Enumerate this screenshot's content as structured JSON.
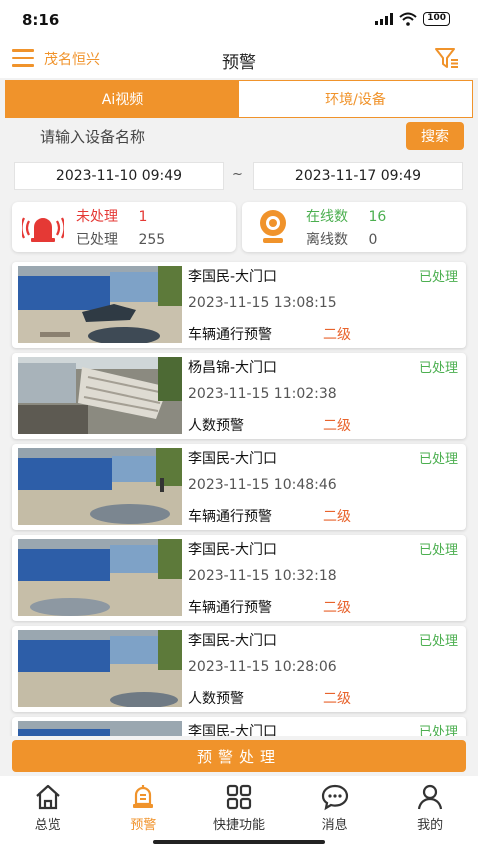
{
  "status_bar": {
    "time": "8:16",
    "battery": "100"
  },
  "header": {
    "company": "茂名恒兴",
    "title": "预警"
  },
  "tabs": [
    {
      "label": "Ai视频",
      "active": true
    },
    {
      "label": "环境/设备",
      "active": false
    }
  ],
  "search": {
    "placeholder": "请输入设备名称",
    "button": "搜索"
  },
  "date_range": {
    "start": "2023-11-10 09:49",
    "separator": "~",
    "end": "2023-11-17 09:49"
  },
  "alarm_stats": {
    "unprocessed_label": "未处理",
    "unprocessed_count": "1",
    "processed_label": "已处理",
    "processed_count": "255"
  },
  "device_stats": {
    "online_label": "在线数",
    "online_count": "16",
    "offline_label": "离线数",
    "offline_count": "0"
  },
  "alerts": [
    {
      "location": "李国民-大门口",
      "status": "已处理",
      "time": "2023-11-15 13:08:15",
      "type": "车辆通行预警",
      "level": "二级"
    },
    {
      "location": "杨昌锦-大门口",
      "status": "已处理",
      "time": "2023-11-15 11:02:38",
      "type": "人数预警",
      "level": "二级"
    },
    {
      "location": "李国民-大门口",
      "status": "已处理",
      "time": "2023-11-15 10:48:46",
      "type": "车辆通行预警",
      "level": "二级"
    },
    {
      "location": "李国民-大门口",
      "status": "已处理",
      "time": "2023-11-15 10:32:18",
      "type": "车辆通行预警",
      "level": "二级"
    },
    {
      "location": "李国民-大门口",
      "status": "已处理",
      "time": "2023-11-15 10:28:06",
      "type": "人数预警",
      "level": "二级"
    },
    {
      "location": "李国民-大门口",
      "status": "已处理"
    }
  ],
  "action_button": "预警处理",
  "bottom_nav": [
    {
      "label": "总览",
      "icon": "home-icon"
    },
    {
      "label": "预警",
      "icon": "bell-icon",
      "active": true
    },
    {
      "label": "快捷功能",
      "icon": "grid-icon"
    },
    {
      "label": "消息",
      "icon": "message-icon"
    },
    {
      "label": "我的",
      "icon": "user-icon"
    }
  ],
  "colors": {
    "accent": "#f0932b",
    "processed": "#4caf50",
    "alarm_red": "#e53935",
    "level": "#e8632c"
  }
}
